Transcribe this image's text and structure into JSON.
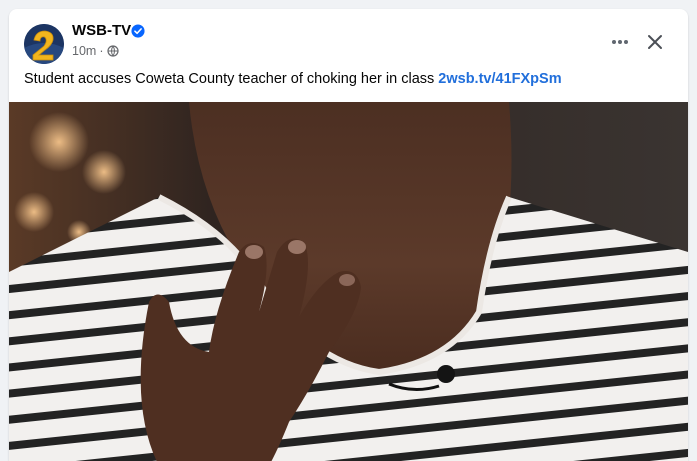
{
  "post": {
    "page_name": "WSB-TV",
    "verified_icon": "verified-badge-icon",
    "timestamp": "10m",
    "separator": "·",
    "audience_icon": "globe-icon",
    "caption_text": "Student accuses Coweta County teacher of choking her in class ",
    "link_text": "2wsb.tv/41FXpSm",
    "more_icon": "more-options-icon",
    "close_icon": "close-icon",
    "image_icon": "post-photo"
  },
  "colors": {
    "link": "#216fdb",
    "verified": "#0866ff",
    "background": "#f0f2f5"
  }
}
